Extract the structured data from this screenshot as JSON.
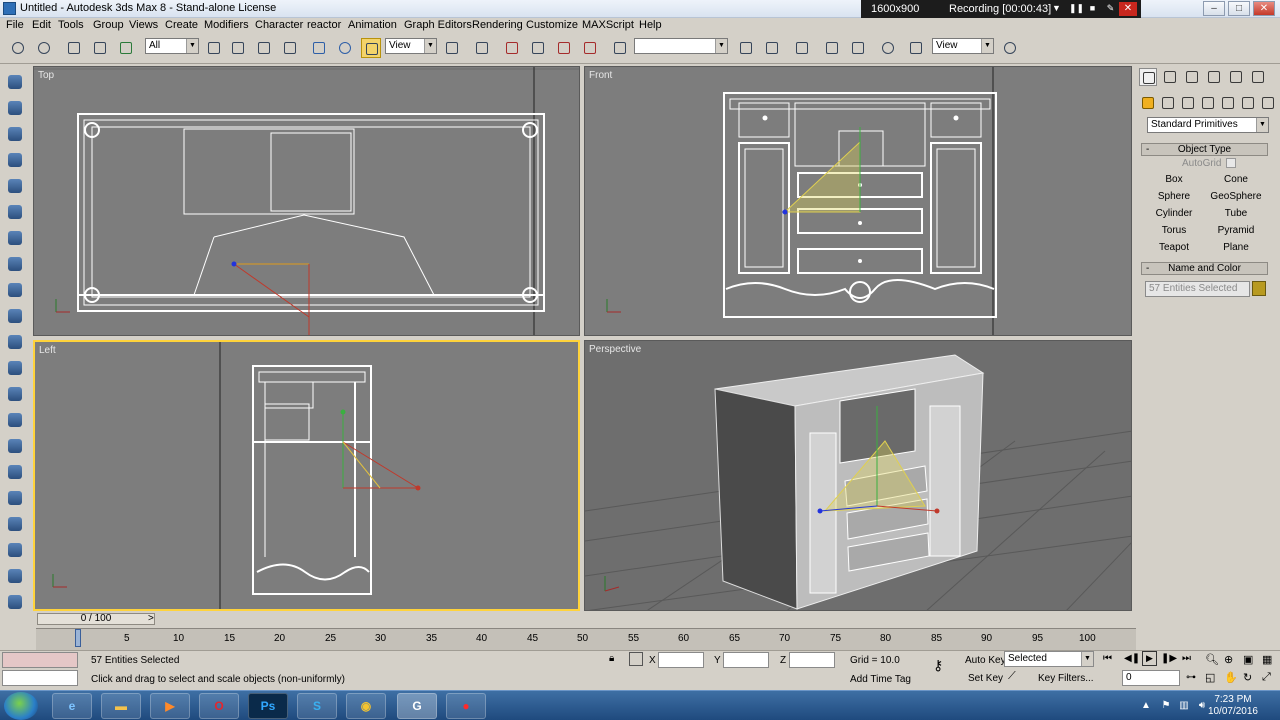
{
  "window": {
    "title": "Untitled - Autodesk 3ds Max 8 - Stand-alone License"
  },
  "recorder": {
    "resolution": "1600x900",
    "status": "Recording [00:00:43]"
  },
  "menu": [
    "File",
    "Edit",
    "Tools",
    "Group",
    "Views",
    "Create",
    "Modifiers",
    "Character",
    "reactor",
    "Animation",
    "Graph Editors",
    "Rendering",
    "Customize",
    "MAXScript",
    "Help"
  ],
  "toolbar": {
    "selection_filter": "All",
    "ref_coord": "View",
    "named_selection": "",
    "render_view": "View"
  },
  "viewports": {
    "top": "Top",
    "front": "Front",
    "left": "Left",
    "perspective": "Perspective"
  },
  "command_panel": {
    "category": "Standard Primitives",
    "object_type_title": "Object Type",
    "autogrid": "AutoGrid",
    "buttons": [
      "Box",
      "Cone",
      "Sphere",
      "GeoSphere",
      "Cylinder",
      "Tube",
      "Torus",
      "Pyramid",
      "Teapot",
      "Plane"
    ],
    "name_color_title": "Name and Color",
    "name_field": "57 Entities Selected"
  },
  "timeline": {
    "frame": "0 / 100",
    "ticks": [
      "0",
      "5",
      "10",
      "15",
      "20",
      "25",
      "30",
      "35",
      "40",
      "45",
      "50",
      "55",
      "60",
      "65",
      "70",
      "75",
      "80",
      "85",
      "90",
      "95",
      "100"
    ]
  },
  "status": {
    "selection": "57 Entities Selected",
    "prompt": "Click and drag to select and scale objects (non-uniformly)",
    "x_label": "X",
    "y_label": "Y",
    "z_label": "Z",
    "grid": "Grid = 10.0",
    "add_time_tag": "Add Time Tag",
    "auto_key": "Auto Key",
    "set_key": "Set Key",
    "key_mode": "Selected",
    "key_filters": "Key Filters...",
    "current_frame": "0"
  },
  "taskbar": {
    "time": "7:23 PM",
    "date": "10/07/2016"
  },
  "colors": {
    "active_viewport": "#ffd33b",
    "viewport_bg": "#7d7d7d",
    "wire": "#ffffff"
  }
}
